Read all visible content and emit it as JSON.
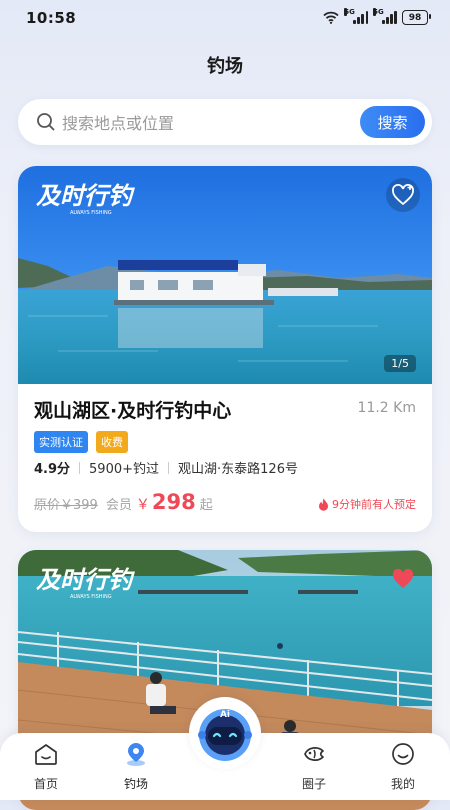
{
  "status_bar": {
    "time": "10:58",
    "net1": "5G",
    "net2": "5G",
    "battery": "98"
  },
  "page": {
    "title": "钓场"
  },
  "search": {
    "placeholder": "搜索地点或位置",
    "button_label": "搜索"
  },
  "cards": [
    {
      "brand": "及时行钓",
      "brand_sub": "ALWAYS FISHING",
      "image_counter": "1/5",
      "name": "观山湖区·及时行钓中心",
      "distance": "11.2 Km",
      "tags": [
        "实测认证",
        "收费"
      ],
      "rating": "4.9分",
      "visits": "5900+钓过",
      "address": "观山湖·东泰路126号",
      "original_price_label": "原价￥399",
      "member_label": "会员",
      "currency": "￥",
      "member_price": "298",
      "price_suffix": "起",
      "hot_note": "9分钟前有人预定",
      "favorited": false
    },
    {
      "brand": "及时行钓",
      "brand_sub": "ALWAYS FISHING",
      "favorited": true
    }
  ],
  "nav": {
    "items": [
      {
        "label": "首页",
        "icon": "home-icon"
      },
      {
        "label": "钓场",
        "icon": "location-icon",
        "active": true
      },
      {
        "label": "圈子",
        "icon": "fish-icon"
      },
      {
        "label": "我的",
        "icon": "smile-icon"
      }
    ],
    "ai_label": "Ai"
  },
  "colors": {
    "accent": "#2f86f0",
    "price": "#ef4957",
    "tag_fee": "#f2a91c"
  }
}
